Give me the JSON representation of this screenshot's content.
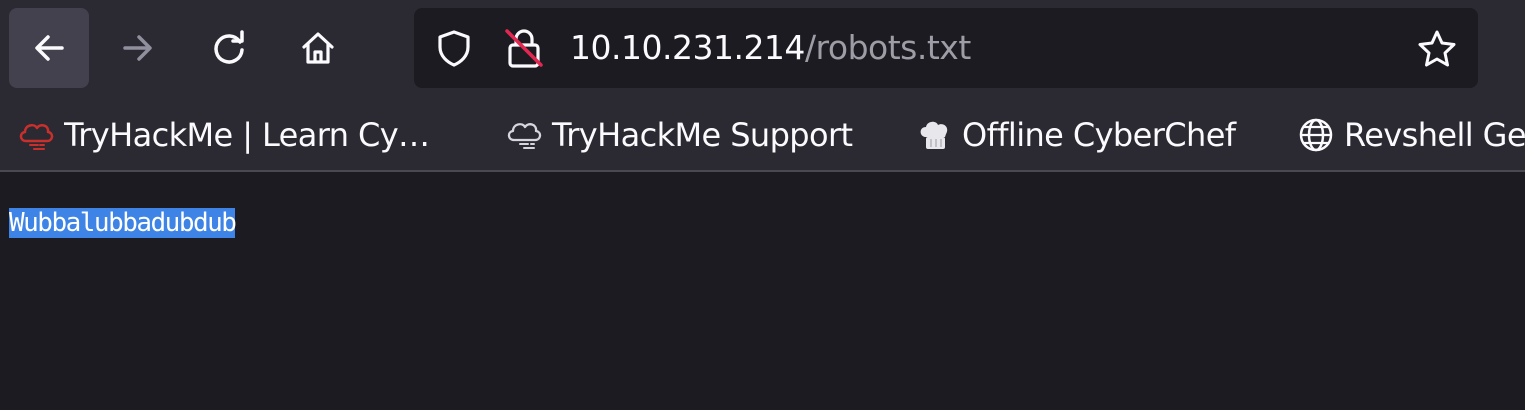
{
  "toolbar": {
    "back_icon": "arrow-left-icon",
    "forward_icon": "arrow-right-icon",
    "reload_icon": "reload-icon",
    "home_icon": "home-icon"
  },
  "urlbar": {
    "host": "10.10.231.214",
    "path": "/robots.txt",
    "shield_icon": "tracking-protection-shield-icon",
    "lock_icon": "insecure-lock-icon",
    "star_icon": "bookmark-star-icon"
  },
  "bookmarks": [
    {
      "label": "TryHackMe | Learn Cy…",
      "icon": "tryhackme-cloud-icon"
    },
    {
      "label": "TryHackMe Support",
      "icon": "cloud-outline-icon"
    },
    {
      "label": "Offline CyberChef",
      "icon": "chef-hat-icon"
    },
    {
      "label": "Revshell Ge",
      "icon": "globe-icon"
    }
  ],
  "page": {
    "text": "Wubbalubbadubdub",
    "selected": true
  },
  "colors": {
    "toolbar_bg": "#2b2a33",
    "content_bg": "#1c1b22",
    "selection": "#3e84e6",
    "tryhackme_red": "#c9302c"
  }
}
